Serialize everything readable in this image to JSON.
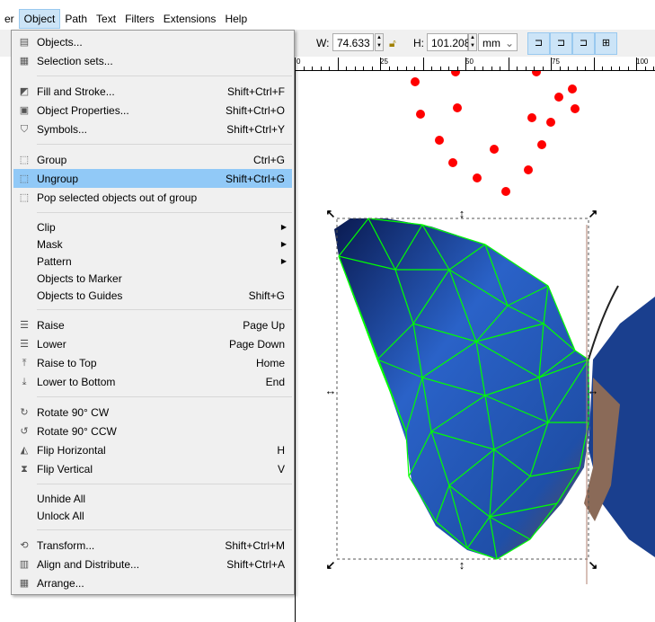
{
  "menubar": {
    "items": [
      {
        "label": "er"
      },
      {
        "label": "Object",
        "active": true
      },
      {
        "label": "Path"
      },
      {
        "label": "Text"
      },
      {
        "label": "Filters"
      },
      {
        "label": "Extensions"
      },
      {
        "label": "Help"
      }
    ]
  },
  "toolbar": {
    "w_label": "W:",
    "w_value": "74.633",
    "h_label": "H:",
    "h_value": "101.208",
    "unit": "mm",
    "lock_icon": "lock-open-icon"
  },
  "ruler": {
    "ticks": [
      "0",
      "25",
      "50",
      "75",
      "100"
    ]
  },
  "menu": {
    "items": [
      {
        "type": "item",
        "label": "Objects...",
        "icon": "objects-icon"
      },
      {
        "type": "item",
        "label": "Selection sets...",
        "icon": "selection-sets-icon"
      },
      {
        "type": "sep"
      },
      {
        "type": "item",
        "label": "Fill and Stroke...",
        "shortcut": "Shift+Ctrl+F",
        "icon": "fill-stroke-icon"
      },
      {
        "type": "item",
        "label": "Object Properties...",
        "shortcut": "Shift+Ctrl+O",
        "icon": "object-properties-icon"
      },
      {
        "type": "item",
        "label": "Symbols...",
        "shortcut": "Shift+Ctrl+Y",
        "icon": "symbols-icon"
      },
      {
        "type": "sep"
      },
      {
        "type": "item",
        "label": "Group",
        "shortcut": "Ctrl+G",
        "icon": "group-icon"
      },
      {
        "type": "item",
        "label": "Ungroup",
        "shortcut": "Shift+Ctrl+G",
        "icon": "ungroup-icon",
        "highlighted": true
      },
      {
        "type": "item",
        "label": "Pop selected objects out of group",
        "icon": "pop-group-icon"
      },
      {
        "type": "sep"
      },
      {
        "type": "item",
        "label": "Clip",
        "submenu": true
      },
      {
        "type": "item",
        "label": "Mask",
        "submenu": true
      },
      {
        "type": "item",
        "label": "Pattern",
        "submenu": true
      },
      {
        "type": "item",
        "label": "Objects to Marker"
      },
      {
        "type": "item",
        "label": "Objects to Guides",
        "shortcut": "Shift+G"
      },
      {
        "type": "sep"
      },
      {
        "type": "item",
        "label": "Raise",
        "shortcut": "Page Up",
        "icon": "raise-icon"
      },
      {
        "type": "item",
        "label": "Lower",
        "shortcut": "Page Down",
        "icon": "lower-icon"
      },
      {
        "type": "item",
        "label": "Raise to Top",
        "shortcut": "Home",
        "icon": "raise-top-icon"
      },
      {
        "type": "item",
        "label": "Lower to Bottom",
        "shortcut": "End",
        "icon": "lower-bottom-icon"
      },
      {
        "type": "sep"
      },
      {
        "type": "item",
        "label": "Rotate 90° CW",
        "icon": "rotate-cw-icon"
      },
      {
        "type": "item",
        "label": "Rotate 90° CCW",
        "icon": "rotate-ccw-icon"
      },
      {
        "type": "item",
        "label": "Flip Horizontal",
        "shortcut": "H",
        "icon": "flip-horizontal-icon"
      },
      {
        "type": "item",
        "label": "Flip Vertical",
        "shortcut": "V",
        "icon": "flip-vertical-icon"
      },
      {
        "type": "sep"
      },
      {
        "type": "item",
        "label": "Unhide All"
      },
      {
        "type": "item",
        "label": "Unlock All"
      },
      {
        "type": "sep"
      },
      {
        "type": "item",
        "label": "Transform...",
        "shortcut": "Shift+Ctrl+M",
        "icon": "transform-icon"
      },
      {
        "type": "item",
        "label": "Align and Distribute...",
        "shortcut": "Shift+Ctrl+A",
        "icon": "align-icon"
      },
      {
        "type": "item",
        "label": "Arrange...",
        "icon": "arrange-icon"
      }
    ]
  },
  "colors": {
    "highlight": "#91c9f7",
    "mesh": "#00ff00",
    "dots": "#ff0000",
    "wing": "#1f4fa8"
  }
}
